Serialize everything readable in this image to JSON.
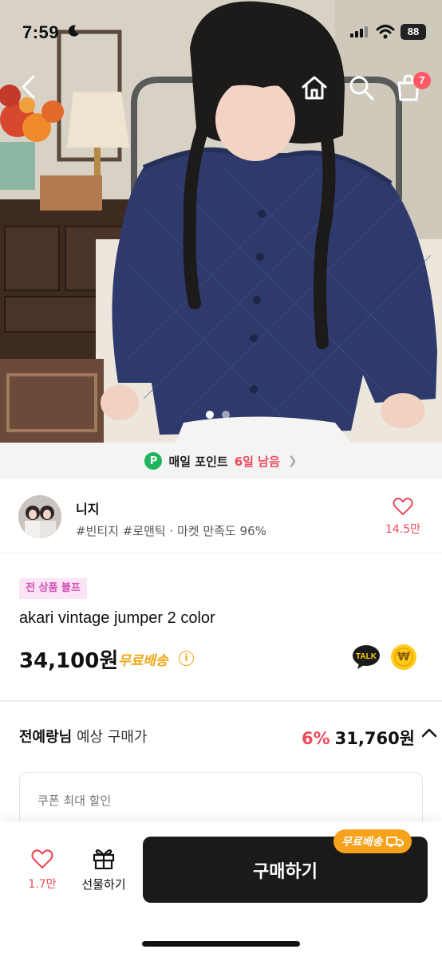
{
  "status_bar": {
    "time": "7:59",
    "battery": "88"
  },
  "nav": {
    "cart_badge": "7"
  },
  "hero": {
    "image_index": 1,
    "image_count": 2
  },
  "points": {
    "label": "매일 포인트",
    "days": "6일 남음",
    "icon_letter": "P"
  },
  "seller": {
    "name": "니지",
    "tags": "#빈티지 #로맨틱 · 마켓 만족도 96%",
    "likes": "14.5만"
  },
  "product": {
    "promo_tag": "전 상품 블프",
    "title": "akari vintage jumper 2 color",
    "price": "34,100원",
    "shipping": "무료배송",
    "talk_label": "TALK",
    "won_symbol": "₩"
  },
  "expected": {
    "user": "전예랑님",
    "label": " 예상 구매가",
    "rate": "6%",
    "price": "31,760원"
  },
  "coupon": {
    "label": "쿠폰 최대 할인"
  },
  "bottom": {
    "wish_count": "1.7만",
    "gift_label": "선물하기",
    "buy_label": "구매하기",
    "freeship_badge": "무료배송"
  },
  "colors": {
    "accent_red": "#ef4a5a",
    "point_green": "#1fb55c",
    "ship_orange": "#f2a514",
    "buy_black": "#1a1a1a"
  }
}
